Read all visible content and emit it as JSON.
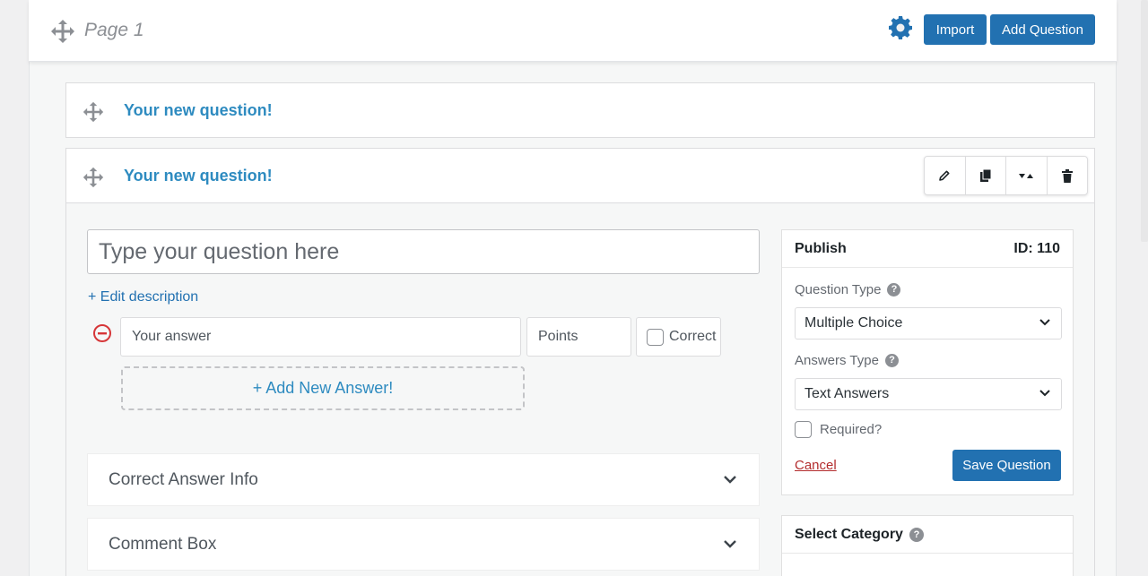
{
  "header": {
    "page_title": "Page 1",
    "import_label": "Import",
    "add_question_label": "Add Question",
    "accent_color": "#2271b1"
  },
  "questions": [
    {
      "title": "Your new question!"
    },
    {
      "title": "Your new question!"
    }
  ],
  "editor": {
    "question_placeholder": "Type your question here",
    "edit_description": "+ Edit description",
    "answer_placeholder": "Your answer",
    "points_placeholder": "Points",
    "correct_label": "Correct",
    "add_answer_label": "+ Add New Answer!",
    "accordions": [
      {
        "label": "Correct Answer Info"
      },
      {
        "label": "Comment Box"
      }
    ]
  },
  "publish": {
    "title": "Publish",
    "id_label": "ID: 110",
    "question_type_label": "Question Type",
    "question_type_value": "Multiple Choice",
    "answers_type_label": "Answers Type",
    "answers_type_value": "Text Answers",
    "required_label": "Required?",
    "cancel_label": "Cancel",
    "save_label": "Save Question"
  },
  "category": {
    "title": "Select Category"
  },
  "icons": {
    "toolbar": [
      "pencil-icon",
      "copy-icon",
      "move-up-down-icon",
      "trash-icon"
    ]
  }
}
